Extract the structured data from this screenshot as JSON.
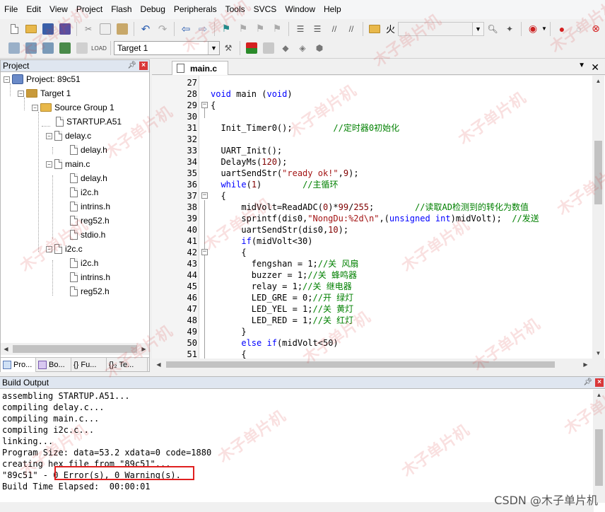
{
  "menu": [
    "File",
    "Edit",
    "View",
    "Project",
    "Flash",
    "Debug",
    "Peripherals",
    "Tools",
    "SVCS",
    "Window",
    "Help"
  ],
  "toolbar": {
    "find_text": "火",
    "target_select": "Target 1",
    "colors": {
      "bookmark": "#1f8a8a",
      "record": "#d42020",
      "debug": "#cc2020"
    }
  },
  "project_panel": {
    "title": "Project",
    "tree": [
      {
        "label": "Project: 89c51",
        "icon": "project-icon",
        "depth": 0,
        "expanded": true
      },
      {
        "label": "Target 1",
        "icon": "target-icon",
        "depth": 1,
        "expanded": true
      },
      {
        "label": "Source Group 1",
        "icon": "folder-icon",
        "depth": 2,
        "expanded": true
      },
      {
        "label": "STARTUP.A51",
        "icon": "file-icon",
        "depth": 3
      },
      {
        "label": "delay.c",
        "icon": "file-icon",
        "depth": 3,
        "expanded": true
      },
      {
        "label": "delay.h",
        "icon": "file-icon",
        "depth": 4
      },
      {
        "label": "main.c",
        "icon": "file-icon",
        "depth": 3,
        "expanded": true
      },
      {
        "label": "delay.h",
        "icon": "file-icon",
        "depth": 4
      },
      {
        "label": "i2c.h",
        "icon": "file-icon",
        "depth": 4
      },
      {
        "label": "intrins.h",
        "icon": "file-icon",
        "depth": 4
      },
      {
        "label": "reg52.h",
        "icon": "file-icon",
        "depth": 4
      },
      {
        "label": "stdio.h",
        "icon": "file-icon",
        "depth": 4
      },
      {
        "label": "i2c.c",
        "icon": "file-icon",
        "depth": 3,
        "expanded": true
      },
      {
        "label": "i2c.h",
        "icon": "file-icon",
        "depth": 4
      },
      {
        "label": "intrins.h",
        "icon": "file-icon",
        "depth": 4
      },
      {
        "label": "reg52.h",
        "icon": "file-icon",
        "depth": 4
      }
    ],
    "tabs": [
      "Pro...",
      "Bo...",
      "{} Fu...",
      "{}₂ Te..."
    ]
  },
  "editor": {
    "active_tab": "main.c",
    "lines": [
      {
        "n": "27",
        "text": ""
      },
      {
        "n": "28",
        "text": "void main (void)"
      },
      {
        "n": "29",
        "text": "{"
      },
      {
        "n": "30",
        "text": ""
      },
      {
        "n": "31",
        "text": "  Init_Timer0();        //定时器0初始化"
      },
      {
        "n": "32",
        "text": ""
      },
      {
        "n": "33",
        "text": "  UART_Init();"
      },
      {
        "n": "34",
        "text": "  DelayMs(120);"
      },
      {
        "n": "35",
        "text": "  uartSendStr(\"ready ok!\",9);"
      },
      {
        "n": "36",
        "text": "  while(1)        //主循环"
      },
      {
        "n": "37",
        "text": "  {"
      },
      {
        "n": "38",
        "text": "      midVolt=ReadADC(0)*99/255;        //读取AD检测到的转化为数值"
      },
      {
        "n": "39",
        "text": "      sprintf(dis0,\"NongDu:%2d\\n\",(unsigned int)midVolt);  //发送"
      },
      {
        "n": "40",
        "text": "      uartSendStr(dis0,10);"
      },
      {
        "n": "41",
        "text": "      if(midVolt<30)"
      },
      {
        "n": "42",
        "text": "      {"
      },
      {
        "n": "43",
        "text": "        fengshan = 1;//关 风扇"
      },
      {
        "n": "44",
        "text": "        buzzer = 1;//关 蜂鸣器"
      },
      {
        "n": "45",
        "text": "        relay = 1;//关 继电器"
      },
      {
        "n": "46",
        "text": "        LED_GRE = 0;//开 绿灯"
      },
      {
        "n": "47",
        "text": "        LED_YEL = 1;//关 黄灯"
      },
      {
        "n": "48",
        "text": "        LED_RED = 1;//关 红灯"
      },
      {
        "n": "49",
        "text": "      }"
      },
      {
        "n": "50",
        "text": "      else if(midVolt<50)"
      },
      {
        "n": "51",
        "text": "      {"
      }
    ]
  },
  "build_output": {
    "title": "Build Output",
    "lines": [
      "assembling STARTUP.A51...",
      "compiling delay.c...",
      "compiling main.c...",
      "compiling i2c.c...",
      "linking...",
      "Program Size: data=53.2 xdata=0 code=1880",
      "creating hex file from \"89c51\"...",
      "\"89c51\" - 0 Error(s), 0 Warning(s).",
      "Build Time Elapsed:  00:00:01"
    ]
  },
  "watermark": "木子单片机",
  "credit": "CSDN @木子单片机"
}
